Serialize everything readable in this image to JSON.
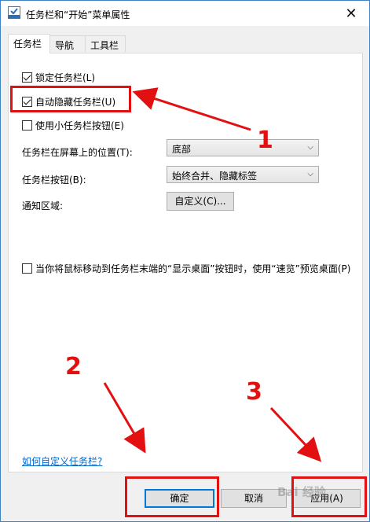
{
  "window": {
    "title": "任务栏和“开始”菜单属性",
    "close_glyph": "✕"
  },
  "tabs": [
    {
      "label": "任务栏",
      "active": true
    },
    {
      "label": "导航",
      "active": false
    },
    {
      "label": "工具栏",
      "active": false
    }
  ],
  "options": {
    "lock_taskbar": {
      "label": "锁定任务栏(L)",
      "checked": true
    },
    "auto_hide": {
      "label": "自动隐藏任务栏(U)",
      "checked": true
    },
    "small_buttons": {
      "label": "使用小任务栏按钮(E)",
      "checked": false
    },
    "peek": {
      "label": "当你将鼠标移动到任务栏末端的“显示桌面”按钮时，使用“速览”预览桌面(P)",
      "checked": false
    }
  },
  "fields": {
    "position_label": "任务栏在屏幕上的位置(T):",
    "position_value": "底部",
    "buttons_label": "任务栏按钮(B):",
    "buttons_value": "始终合并、隐藏标签",
    "notify_label": "通知区域:",
    "customize_label": "自定义(C)..."
  },
  "help_link": "如何自定义任务栏?",
  "footer": {
    "ok": "确定",
    "cancel": "取消",
    "apply": "应用(A)"
  },
  "annotations": [
    "1",
    "2",
    "3"
  ],
  "watermark": "Bai 经验",
  "colors": {
    "annotation_red": "#e21010",
    "accent_blue": "#0078d7",
    "link_blue": "#0066cc"
  }
}
